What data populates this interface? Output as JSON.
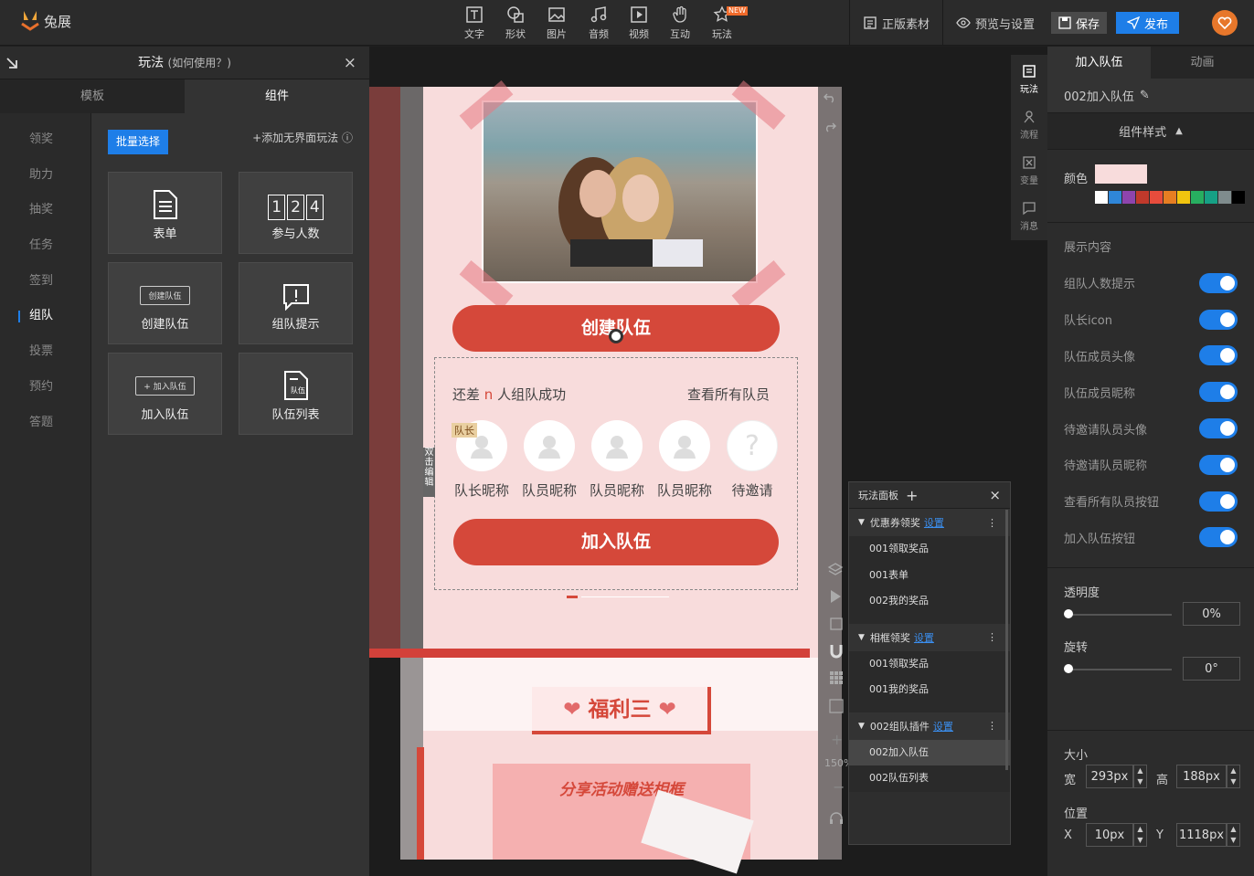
{
  "app": {
    "logo_text": "兔展"
  },
  "toolbar": {
    "tools": [
      {
        "label": "文字",
        "icon": "text-icon"
      },
      {
        "label": "形状",
        "icon": "shape-icon"
      },
      {
        "label": "图片",
        "icon": "image-icon"
      },
      {
        "label": "音频",
        "icon": "audio-icon"
      },
      {
        "label": "视频",
        "icon": "video-icon"
      },
      {
        "label": "互动",
        "icon": "hand-icon"
      },
      {
        "label": "玩法",
        "icon": "star-icon",
        "badge": "NEW"
      }
    ],
    "material": "正版素材",
    "preview": "预览与设置",
    "save": "保存",
    "publish": "发布"
  },
  "left_panel": {
    "title": "玩法",
    "title_hint": "(如何使用？)",
    "close": "×",
    "tabs": [
      "模板",
      "组件"
    ],
    "categories": [
      "领奖",
      "助力",
      "抽奖",
      "任务",
      "签到",
      "组队",
      "投票",
      "预约",
      "答题"
    ],
    "active_category": "组队",
    "batch_select": "批量选择",
    "add_noui": "+添加无界面玩法",
    "cards": [
      {
        "label": "表单",
        "icon": "form-icon"
      },
      {
        "label": "参与人数",
        "icon": "counter-icon",
        "digits": [
          "1",
          "2",
          "4"
        ]
      },
      {
        "label": "创建队伍",
        "icon": "create-team-icon",
        "mini": "创建队伍"
      },
      {
        "label": "组队提示",
        "icon": "alert-icon"
      },
      {
        "label": "加入队伍",
        "icon": "join-team-icon",
        "mini": "+ 加入队伍"
      },
      {
        "label": "队伍列表",
        "icon": "team-list-icon",
        "mini": "队伍"
      }
    ]
  },
  "canvas": {
    "create_button": "创建队伍",
    "team_hint_prefix": "还差",
    "team_hint_n": "n",
    "team_hint_suffix": "人组队成功",
    "view_all": "查看所有队员",
    "captain_tag": "队长",
    "members": [
      "队长昵称",
      "队员昵称",
      "队员昵称",
      "队员昵称",
      "待邀请"
    ],
    "join_button": "加入队伍",
    "edit_label": "双击编辑",
    "section_title": "福利三",
    "section_sub": "分享活动赠送相框",
    "zoom": "150%"
  },
  "play_panel": {
    "title": "玩法面板",
    "add": "+",
    "close": "×",
    "groups": [
      {
        "name": "优惠券领奖",
        "link": "设置",
        "items": [
          "001领取奖品",
          "001表单",
          "002我的奖品"
        ]
      },
      {
        "name": "相框领奖",
        "link": "设置",
        "items": [
          "001领取奖品",
          "001我的奖品"
        ]
      },
      {
        "name": "002组队插件",
        "link": "设置",
        "items": [
          "002加入队伍",
          "002队伍列表"
        ]
      }
    ],
    "selected_item": "002加入队伍"
  },
  "side_icons": [
    {
      "label": "玩法",
      "icon": "play-icon"
    },
    {
      "label": "流程",
      "icon": "flow-icon"
    },
    {
      "label": "变量",
      "icon": "variable-icon"
    },
    {
      "label": "消息",
      "icon": "message-icon"
    }
  ],
  "right_panel": {
    "tabs": [
      "加入队伍",
      "动画"
    ],
    "component_name": "002加入队伍",
    "style_header": "组件样式",
    "color_label": "颜色",
    "color_value": "#f8dcdc",
    "swatches": [
      "#ffffff",
      "#2f86d8",
      "#8e44ad",
      "#c0392b",
      "#e74c3c",
      "#e67e22",
      "#f1c40f",
      "#27ae60",
      "#16a085",
      "#7f8c8d",
      "#000000"
    ],
    "display_title": "展示内容",
    "toggles": [
      "组队人数提示",
      "队长icon",
      "队伍成员头像",
      "队伍成员昵称",
      "待邀请队员头像",
      "待邀请队员昵称",
      "查看所有队员按钮",
      "加入队伍按钮"
    ],
    "opacity_label": "透明度",
    "opacity_value": "0%",
    "rotate_label": "旋转",
    "rotate_value": "0°",
    "size_label": "大小",
    "width_label": "宽",
    "width_value": "293px",
    "height_label": "高",
    "height_value": "188px",
    "pos_label": "位置",
    "x_label": "X",
    "x_value": "10px",
    "y_label": "Y",
    "y_value": "1118px"
  }
}
